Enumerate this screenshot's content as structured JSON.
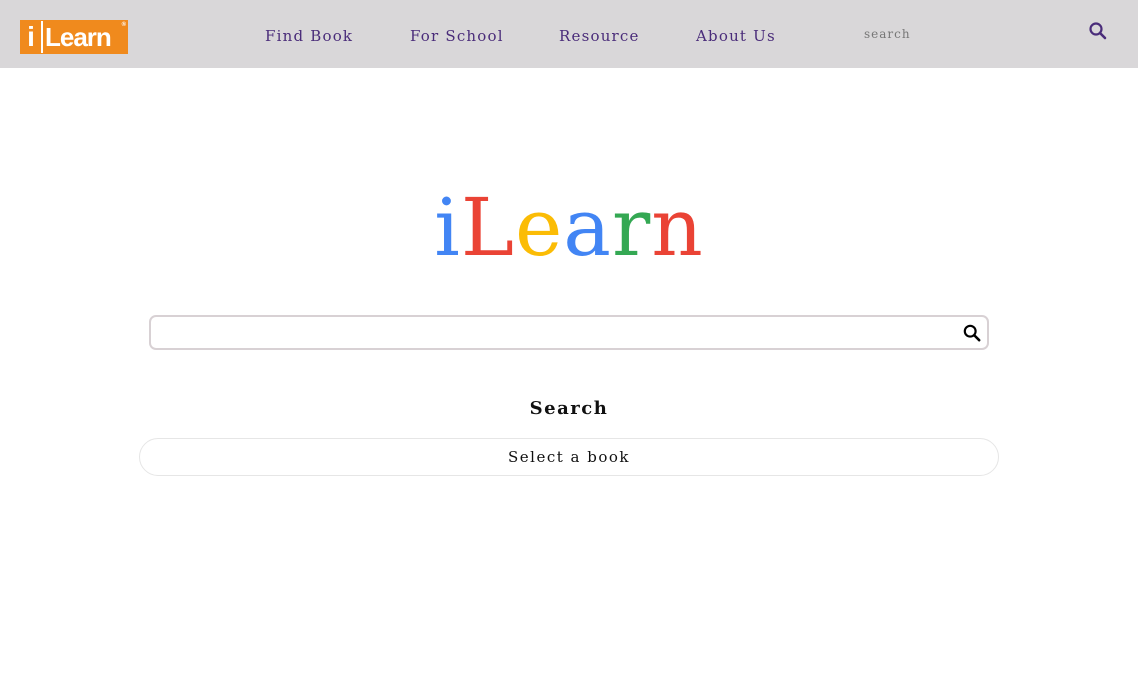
{
  "header": {
    "logo": {
      "letter": "i",
      "text": "Learn",
      "reg_mark": "®"
    },
    "nav": [
      {
        "label": "Find Book"
      },
      {
        "label": "For School"
      },
      {
        "label": "Resource"
      },
      {
        "label": "About Us"
      }
    ],
    "search": {
      "placeholder": "search",
      "value": "",
      "icon": "search-icon"
    }
  },
  "main": {
    "brand_letters": [
      {
        "char": "i",
        "color": "#4285f4"
      },
      {
        "char": "L",
        "color": "#ea4335"
      },
      {
        "char": "e",
        "color": "#fbbc05"
      },
      {
        "char": "a",
        "color": "#4285f4"
      },
      {
        "char": "r",
        "color": "#34a853"
      },
      {
        "char": "n",
        "color": "#ea4335"
      }
    ],
    "search": {
      "placeholder": "",
      "value": "",
      "icon": "search-icon"
    },
    "heading": "Search",
    "select_book_label": "Select a book"
  },
  "colors": {
    "header_bg": "#d9d7d9",
    "nav_text": "#4a2c7a",
    "logo_orange": "#f08a1d"
  }
}
